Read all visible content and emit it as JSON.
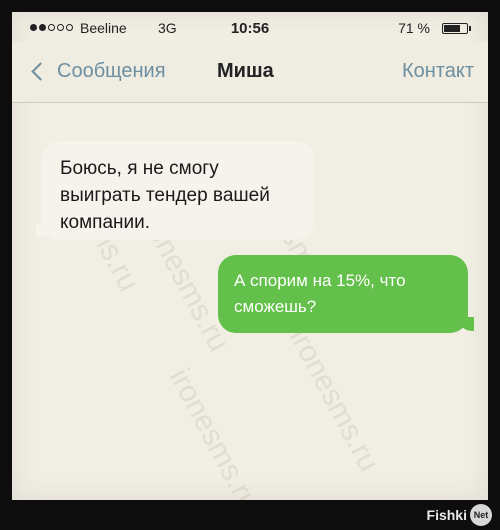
{
  "status_bar": {
    "carrier": "Beeline",
    "network": "3G",
    "time": "10:56",
    "battery_percent": "71 %",
    "battery_level": 0.71,
    "signal_strength": 2,
    "signal_total": 5
  },
  "nav": {
    "back_label": "Сообщения",
    "title": "Миша",
    "contact_label": "Контакт"
  },
  "messages": [
    {
      "direction": "incoming",
      "text": "Боюсь, я не смогу\nвыиграть тендер вашей\nкомпании."
    },
    {
      "direction": "outgoing",
      "text": "А спорим на 15%, что\nсможешь?"
    }
  ],
  "watermark": "ironesms.ru",
  "badge": {
    "brand": "Fishki",
    "net": "Net"
  },
  "colors": {
    "background": "#f1eee4",
    "accent": "#6d8fa0",
    "outgoing_bubble": "#63c04a",
    "incoming_bubble": "#f6f2ec"
  }
}
